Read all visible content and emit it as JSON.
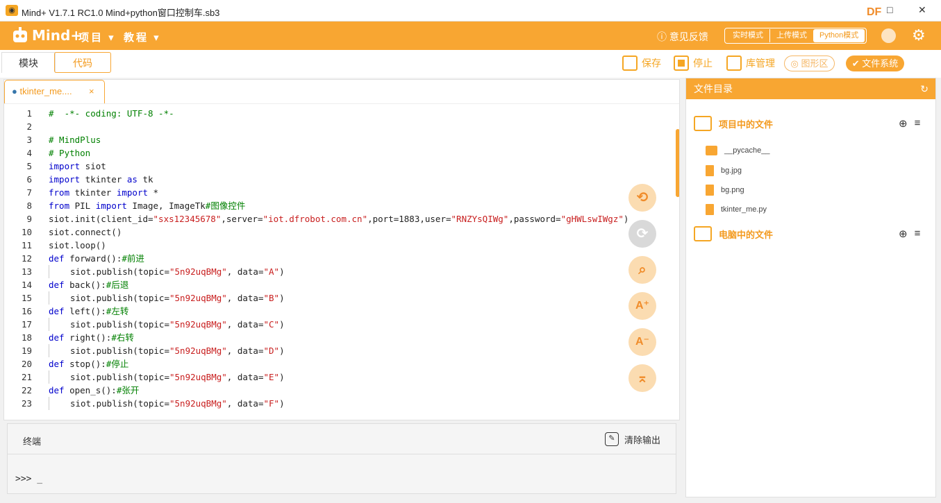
{
  "window": {
    "title": "Mind+ V1.7.1 RC1.0    Mind+python窗口控制车.sb3",
    "brand": "DF",
    "minimize": "—",
    "maximize": "□",
    "close": "✕"
  },
  "menubar": {
    "logo": "Mind+",
    "menus": [
      {
        "label": "项目 ▾"
      },
      {
        "label": "教程 ▾"
      }
    ],
    "feedback": "意见反馈",
    "modes": [
      {
        "label": "实时模式"
      },
      {
        "label": "上传模式"
      },
      {
        "label": "Python模式"
      }
    ]
  },
  "toolbar": {
    "tab_blocks": "模块",
    "tab_code": "代码",
    "save": "保存",
    "stop": "停止",
    "library": "库管理",
    "graphic": "◎ 图形区",
    "filesystem": "✔ 文件系统"
  },
  "editor": {
    "file_tab": "tkinter_me....",
    "close": "×",
    "lines": [
      {
        "n": "1"
      },
      {
        "n": "2"
      },
      {
        "n": "3"
      },
      {
        "n": "4"
      },
      {
        "n": "5"
      },
      {
        "n": "6"
      },
      {
        "n": "7"
      },
      {
        "n": "8"
      },
      {
        "n": "9"
      },
      {
        "n": "10"
      },
      {
        "n": "11"
      },
      {
        "n": "12"
      },
      {
        "n": "13"
      },
      {
        "n": "14"
      },
      {
        "n": "15"
      },
      {
        "n": "16"
      },
      {
        "n": "17"
      },
      {
        "n": "18"
      },
      {
        "n": "19"
      },
      {
        "n": "20"
      },
      {
        "n": "21"
      },
      {
        "n": "22"
      },
      {
        "n": "23"
      }
    ],
    "code": {
      "l1": "#  -*- coding: UTF-8 -*-",
      "l3": "# MindPlus",
      "l4": "# Python",
      "import": "import",
      "from": "from",
      "as": "as",
      "def": "def",
      "l5": " siot",
      "l6a": " tkinter ",
      "l6b": " tk",
      "l7a": " tkinter ",
      "l7b": " *",
      "l8a": " PIL ",
      "l8b": " Image, ImageTk",
      "l8c": "#图像控件",
      "l9a": "siot.init(client_id=",
      "l9b": "\"sxs12345678\"",
      "l9c": ",server=",
      "l9d": "\"iot.dfrobot.com.cn\"",
      "l9e": ",port=1883,user=",
      "l9f": "\"RNZYsQIWg\"",
      "l9g": ",password=",
      "l9h": "\"gHWLswIWgz\"",
      "l9i": ")",
      "l10": "siot.connect()",
      "l11": "siot.loop()",
      "l12": " forward():",
      "l12c": "#前进",
      "pub": "siot.publish(topic=",
      "topic": "\"5n92uqBMg\"",
      "data_kw": ", data=",
      "close_paren": ")",
      "l13d": "\"A\"",
      "l14": " back():",
      "l14c": "#后退",
      "l15d": "\"B\"",
      "l16": " left():",
      "l16c": "#左转",
      "l17d": "\"C\"",
      "l18": " right():",
      "l18c": "#右转",
      "l19d": "\"D\"",
      "l20": " stop():",
      "l20c": "#停止",
      "l21d": "\"E\"",
      "l22": " open_s():",
      "l22c": "#张开",
      "l23d": "\"F\""
    }
  },
  "side_buttons": {
    "undo": "⟲",
    "redo": "⟳",
    "search": "⌕",
    "font_up": "A⁺",
    "font_down": "A⁻",
    "top": "⌅"
  },
  "terminal": {
    "title": "终端",
    "clear": "清除输出",
    "prompt": ">>> _"
  },
  "files": {
    "header": "文件目录",
    "refresh": "↻",
    "project_section": "项目中的文件",
    "computer_section": "电脑中的文件",
    "new_file": "⊕",
    "menu": "≡",
    "items": [
      {
        "name": "__pycache__"
      },
      {
        "name": "bg.jpg"
      },
      {
        "name": "bg.png"
      },
      {
        "name": "tkinter_me.py"
      }
    ]
  }
}
